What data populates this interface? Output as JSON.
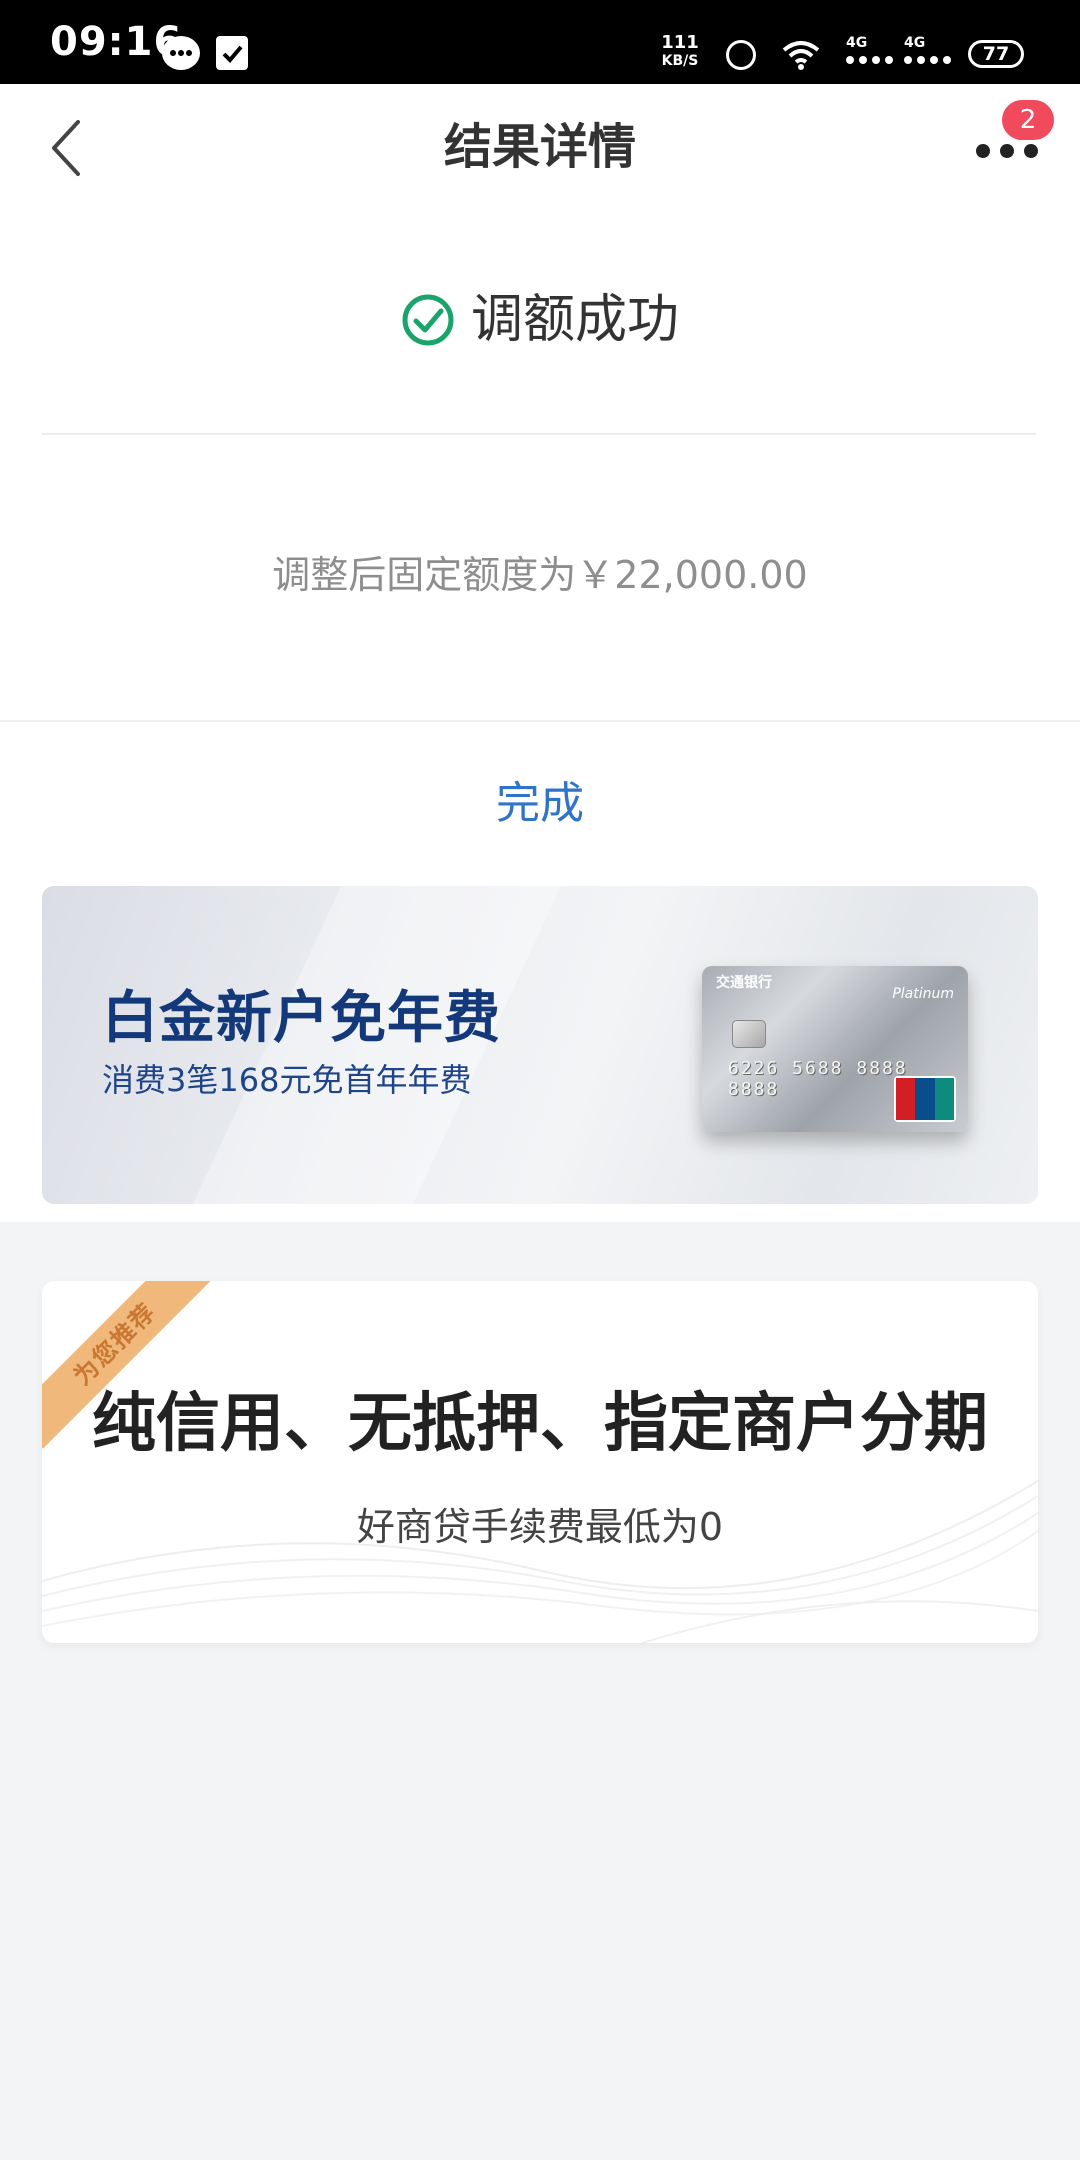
{
  "status_bar": {
    "time": "09:16",
    "network_speed_value": "111",
    "network_speed_unit": "KB/S",
    "signal_label": "4G",
    "battery": "77"
  },
  "header": {
    "title": "结果详情",
    "notification_count": "2"
  },
  "result": {
    "status_text": "调额成功",
    "detail_text": "调整后固定额度为￥22,000.00",
    "done_label": "完成",
    "success_color": "#1aa36a"
  },
  "banner": {
    "title": "白金新户免年费",
    "subtitle": "消费3笔168元免首年年费"
  },
  "recommendation": {
    "ribbon": "为您推荐",
    "title": "纯信用、无抵押、指定商户分期",
    "subtitle": "好商贷手续费最低为0"
  },
  "colors": {
    "accent_blue": "#2f74c7",
    "badge_red": "#f04a5c",
    "banner_navy": "#13397a",
    "ribbon_orange": "#f0b87b"
  }
}
